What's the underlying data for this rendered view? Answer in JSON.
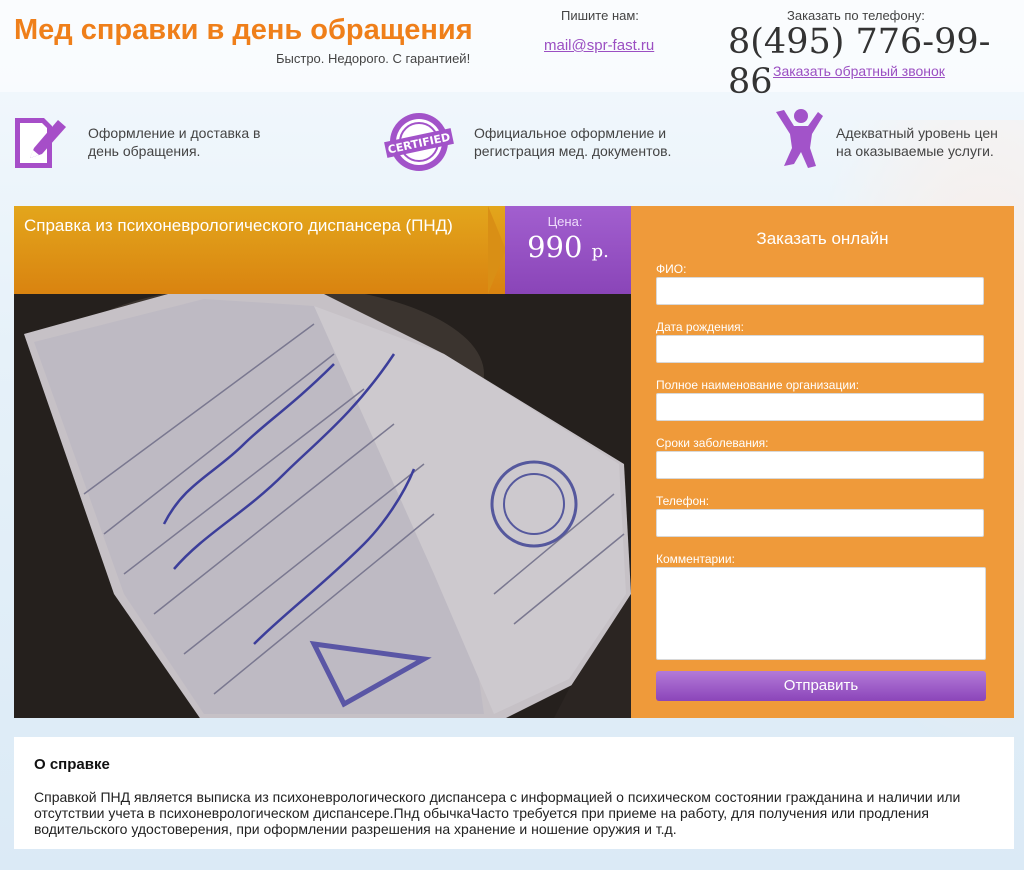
{
  "header": {
    "title": "Мед справки в день обращения",
    "slogan": "Быстро. Недорого. С гарантией!",
    "write_label": "Пишите нам:",
    "email": "mail@spr-fast.ru",
    "order_label": "Заказать по телефону:",
    "phone": "8(495) 776-99-86",
    "callback": "Заказать обратный звонок"
  },
  "features": [
    {
      "icon": "document-pen-icon",
      "text": "Оформление и доставка в день обращения."
    },
    {
      "icon": "certified-stamp-icon",
      "text": "Официальное оформление и регистрация мед. документов."
    },
    {
      "icon": "jumping-person-icon",
      "text": "Адекватный уровень цен на оказываемые услуги."
    }
  ],
  "product": {
    "title": "Справка из психоневрологического диспансера (ПНД)",
    "price_label": "Цена:",
    "price": "990",
    "currency": "р."
  },
  "form": {
    "title": "Заказать онлайн",
    "fields": [
      {
        "label": "ФИО:"
      },
      {
        "label": "Дата рождения:"
      },
      {
        "label": "Полное наименование организации:"
      },
      {
        "label": "Сроки заболевания:"
      },
      {
        "label": "Телефон:"
      }
    ],
    "comment_label": "Комментарии:",
    "submit": "Отправить"
  },
  "about": {
    "title": "О справке",
    "text": "Справкой ПНД является выписка из психоневрологического диспансера с информацией о психическом состоянии гражданина и наличии или отсутствии учета в психоневрологическом диспансере.Пнд обычкаЧасто требуется при приеме на работу, для получения или продления водительского удостоверения, при оформлении разрешения на хранение и ношение оружия и т.д."
  },
  "colors": {
    "accent_orange": "#ef7f1a",
    "accent_purple": "#9b4fc2",
    "form_bg": "#ef9a3a"
  }
}
